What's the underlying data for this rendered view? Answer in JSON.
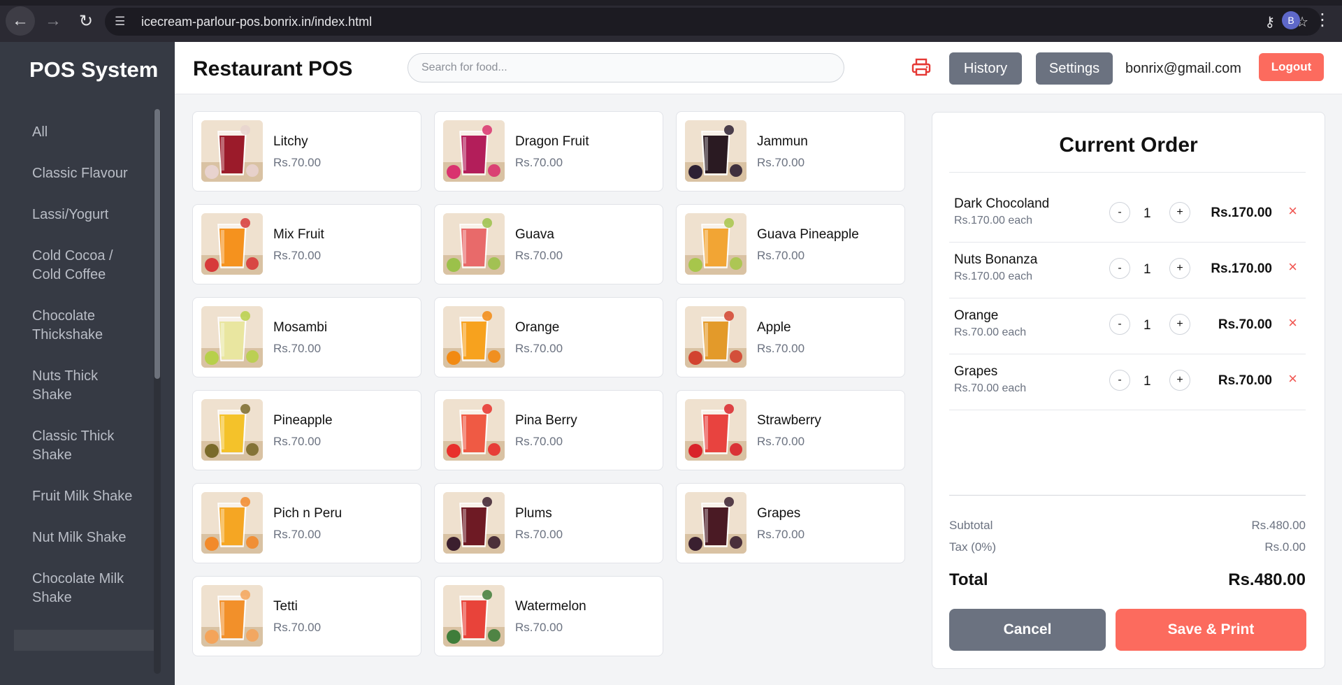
{
  "browser": {
    "url": "icecream-parlour-pos.bonrix.in/index.html",
    "profile_initial": "B"
  },
  "sidebar": {
    "title": "POS System",
    "items": [
      {
        "label": "All"
      },
      {
        "label": "Classic Flavour"
      },
      {
        "label": "Lassi/Yogurt"
      },
      {
        "label": "Cold Cocoa / Cold Coffee"
      },
      {
        "label": "Chocolate Thickshake"
      },
      {
        "label": "Nuts Thick Shake"
      },
      {
        "label": "Classic Thick Shake"
      },
      {
        "label": "Fruit Milk Shake"
      },
      {
        "label": "Nut Milk Shake"
      },
      {
        "label": "Chocolate Milk Shake"
      }
    ]
  },
  "header": {
    "title": "Restaurant POS",
    "search_placeholder": "Search for food...",
    "history_label": "History",
    "settings_label": "Settings",
    "user_email": "bonrix@gmail.com",
    "logout_label": "Logout"
  },
  "products": [
    {
      "name": "Litchy",
      "price": "Rs.70.00",
      "color": "#9b1b2a",
      "fruit": "#e8d3cf"
    },
    {
      "name": "Dragon Fruit",
      "price": "Rs.70.00",
      "color": "#b31e5a",
      "fruit": "#d9336f"
    },
    {
      "name": "Jammun",
      "price": "Rs.70.00",
      "color": "#2a1a22",
      "fruit": "#2d2033"
    },
    {
      "name": "Mix Fruit",
      "price": "Rs.70.00",
      "color": "#f5921e",
      "fruit": "#d73a3a"
    },
    {
      "name": "Guava",
      "price": "Rs.70.00",
      "color": "#e86a6a",
      "fruit": "#9bc14a"
    },
    {
      "name": "Guava Pineapple",
      "price": "Rs.70.00",
      "color": "#f2a534",
      "fruit": "#a7c64b"
    },
    {
      "name": "Mosambi",
      "price": "Rs.70.00",
      "color": "#e9e6a0",
      "fruit": "#b7d04a"
    },
    {
      "name": "Orange",
      "price": "Rs.70.00",
      "color": "#f7a21e",
      "fruit": "#f28a12"
    },
    {
      "name": "Apple",
      "price": "Rs.70.00",
      "color": "#e39a2a",
      "fruit": "#d2432f"
    },
    {
      "name": "Pineapple",
      "price": "Rs.70.00",
      "color": "#f4c22a",
      "fruit": "#7a6a2a"
    },
    {
      "name": "Pina Berry",
      "price": "Rs.70.00",
      "color": "#ef5a44",
      "fruit": "#e8302c"
    },
    {
      "name": "Strawberry",
      "price": "Rs.70.00",
      "color": "#e8433f",
      "fruit": "#d9242a"
    },
    {
      "name": "Pich n Peru",
      "price": "Rs.70.00",
      "color": "#f5a623",
      "fruit": "#f28a2a"
    },
    {
      "name": "Plums",
      "price": "Rs.70.00",
      "color": "#6e1a24",
      "fruit": "#3b1f2e"
    },
    {
      "name": "Grapes",
      "price": "Rs.70.00",
      "color": "#4a1a24",
      "fruit": "#3a2030"
    },
    {
      "name": "Tetti",
      "price": "Rs.70.00",
      "color": "#f2902a",
      "fruit": "#f4a45a"
    },
    {
      "name": "Watermelon",
      "price": "Rs.70.00",
      "color": "#e8433a",
      "fruit": "#3f7d3a"
    }
  ],
  "order": {
    "title": "Current Order",
    "items": [
      {
        "name": "Dark Chocoland",
        "each": "Rs.170.00 each",
        "qty": "1",
        "total": "Rs.170.00"
      },
      {
        "name": "Nuts Bonanza",
        "each": "Rs.170.00 each",
        "qty": "1",
        "total": "Rs.170.00"
      },
      {
        "name": "Orange",
        "each": "Rs.70.00 each",
        "qty": "1",
        "total": "Rs.70.00"
      },
      {
        "name": "Grapes",
        "each": "Rs.70.00 each",
        "qty": "1",
        "total": "Rs.70.00"
      }
    ],
    "minus_label": "-",
    "plus_label": "+",
    "remove_label": "×",
    "subtotal_label": "Subtotal",
    "subtotal_value": "Rs.480.00",
    "tax_label": "Tax (0%)",
    "tax_value": "Rs.0.00",
    "total_label": "Total",
    "total_value": "Rs.480.00",
    "cancel_label": "Cancel",
    "save_label": "Save & Print"
  },
  "colors": {
    "accent": "#fc6b5e",
    "gray_button": "#6b7280",
    "sidebar_bg": "#363a44",
    "remove": "#f0544f"
  }
}
